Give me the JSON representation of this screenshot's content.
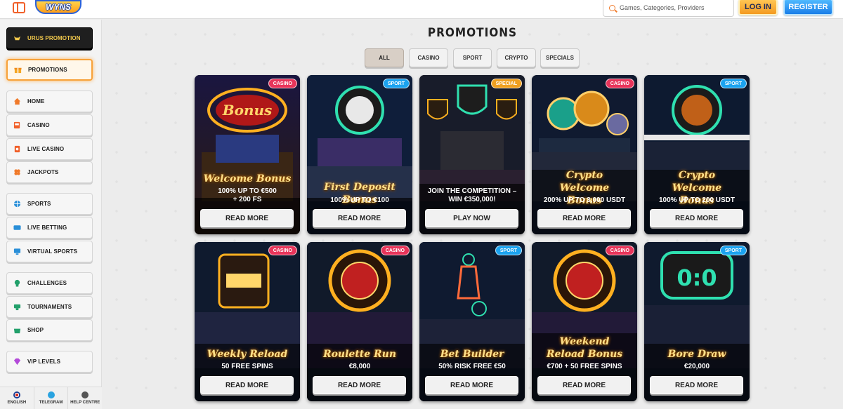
{
  "header": {
    "logo_text": "WYNS",
    "search_placeholder": "Games, Categories, Providers",
    "login_label": "LOG IN",
    "register_label": "REGISTER"
  },
  "sidebar": {
    "items": [
      {
        "label": "URUS PROMOTION"
      },
      {
        "label": "PROMOTIONS"
      },
      {
        "label": "HOME"
      },
      {
        "label": "CASINO"
      },
      {
        "label": "LIVE CASINO"
      },
      {
        "label": "JACKPOTS"
      },
      {
        "label": "SPORTS"
      },
      {
        "label": "LIVE BETTING"
      },
      {
        "label": "VIRTUAL SPORTS"
      },
      {
        "label": "CHALLENGES"
      },
      {
        "label": "TOURNAMENTS"
      },
      {
        "label": "SHOP"
      },
      {
        "label": "VIP LEVELS"
      }
    ],
    "footer": [
      {
        "label": "ENGLISH"
      },
      {
        "label": "TELEGRAM"
      },
      {
        "label": "HELP CENTRE"
      }
    ]
  },
  "main": {
    "title": "PROMOTIONS",
    "filters": [
      "ALL",
      "CASINO",
      "SPORT",
      "CRYPTO",
      "SPECIALS"
    ],
    "cards": [
      {
        "badge": "CASINO",
        "title": "Welcome Bonus",
        "sub": "100% UP TO €500\n+ 200 FS",
        "button": "READ MORE"
      },
      {
        "badge": "SPORT",
        "title": "First Deposit Bonus",
        "sub": "100% UP TO €100",
        "button": "READ MORE"
      },
      {
        "badge": "SPECIAL",
        "title": "",
        "sub": "JOIN THE COMPETITION –\nWIN €350,000!",
        "button": "PLAY NOW"
      },
      {
        "badge": "CASINO",
        "title": "Crypto Welcome Bonus",
        "sub": "200% UP TO 3,000 USDT",
        "button": "READ MORE"
      },
      {
        "badge": "SPORT",
        "title": "Crypto Welcome Bonus",
        "sub": "100% UP TO 200 USDT",
        "button": "READ MORE"
      },
      {
        "badge": "CASINO",
        "title": "Weekly Reload",
        "sub": "50 FREE SPINS",
        "button": "READ MORE"
      },
      {
        "badge": "CASINO",
        "title": "Roulette Run",
        "sub": "€8,000",
        "button": "READ MORE"
      },
      {
        "badge": "SPORT",
        "title": "Bet Builder",
        "sub": "50% RISK FREE €50",
        "button": "READ MORE"
      },
      {
        "badge": "CASINO",
        "title": "Weekend Reload Bonus",
        "sub": "€700 + 50 FREE SPINS",
        "button": "READ MORE"
      },
      {
        "badge": "SPORT",
        "title": "Bore Draw",
        "sub": "€20,000",
        "button": "READ MORE"
      }
    ]
  },
  "colors": {
    "accent_orange": "#f49b21",
    "accent_blue": "#1a7ee8",
    "badge_casino": "#e8345a",
    "badge_sport": "#1ba3f0",
    "badge_special": "#f0a020"
  }
}
